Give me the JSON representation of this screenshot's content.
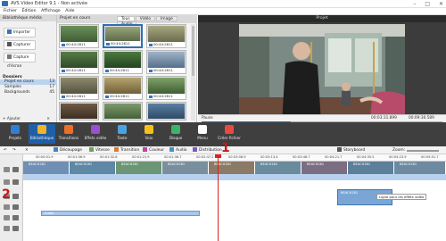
{
  "window": {
    "title": "AVS Video Editor 9.1 - Non activée",
    "controls": [
      "–",
      "□",
      "✕"
    ]
  },
  "menu": [
    "Fichier",
    "Édition",
    "Affichage",
    "Aide"
  ],
  "library": {
    "header": "Bibliothèque média",
    "buttons": [
      "Importer",
      "Capturer",
      "Capture d'écran"
    ],
    "folders_title": "Dossiers",
    "folders": [
      {
        "label": "Projet en cours",
        "count": "13"
      },
      {
        "label": "Samples",
        "count": "17"
      },
      {
        "label": "Backgrounds",
        "count": "45"
      }
    ],
    "add_label": "Ajouter",
    "remove_label": "Supprimer"
  },
  "media": {
    "header": "Projet en cours",
    "tabs": [
      "Tous",
      "Vidéo",
      "Image",
      "Audio"
    ],
    "active_tab": "Tous",
    "thumbs": [
      {
        "label": "00:44:2811"
      },
      {
        "label": "00:44:2811"
      },
      {
        "label": "00:44:2811"
      },
      {
        "label": "00:44:2811"
      },
      {
        "label": "00:44:2811"
      },
      {
        "label": "00:44:2811"
      },
      {
        "label": "00:44:2811"
      },
      {
        "label": "00:44:2811"
      },
      {
        "label": "00:44:2811"
      },
      {
        "label": "00:44:2811"
      },
      {
        "label": "00:44:2811"
      },
      {
        "label": "00:44:2811"
      }
    ]
  },
  "preview": {
    "title": "Projet",
    "status": "Pause",
    "time_current": "00:03:31.899",
    "time_total": "00:09:30.589",
    "speed": "1x",
    "progress": 0.37
  },
  "toolbar": {
    "items": [
      "Projets",
      "Bibliothèque",
      "Transitions",
      "Effets vidéo",
      "Texte",
      "Voix",
      "Disque",
      "Menu",
      "Créer fichier"
    ],
    "active": "Bibliothèque",
    "colors": [
      "#2f7fd4",
      "#f0b429",
      "#e8702a",
      "#9c4fd0",
      "#4aa3df",
      "#f2c218",
      "#3bb36b",
      "#ffffff",
      "#e94a3f"
    ]
  },
  "timeline": {
    "tools": [
      "Découpage",
      "Vitesse",
      "Transition",
      "Couleur",
      "Audio",
      "Distribution"
    ],
    "storyboard_label": "Storyboard",
    "zoom_label": "Zoom:",
    "ruler": [
      "00:00:01.9",
      "00:01:56.9",
      "00:01:32.8",
      "00:01:21.9",
      "00:01:36.7",
      "00:02:47.2",
      "00:03:08.9",
      "00:03:13.4",
      "00:03:48.7",
      "00:04:21.7",
      "00:04:35.5",
      "00:05:23.9",
      "00:05:51.7"
    ],
    "clips": [
      "BEACH281",
      "BEACH281",
      "BEACH281",
      "BEACH281",
      "BEACH281",
      "BEACH281",
      "BEACH281",
      "BEACH281",
      "BEACH281"
    ],
    "overlay_clip": "BEACH281",
    "overlay_tooltip": "Ligne pour les effets vidéo",
    "audio_clip": "Audio"
  },
  "annotations": [
    "1",
    "2"
  ]
}
